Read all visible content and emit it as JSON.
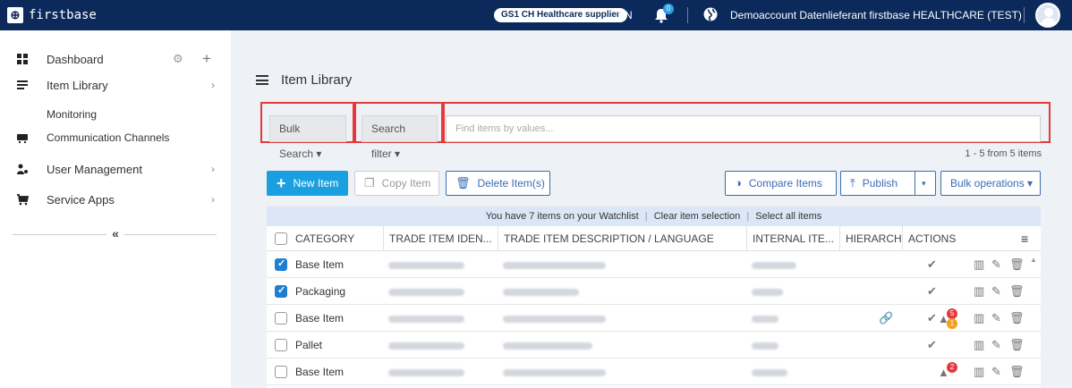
{
  "topbar": {
    "logo_text": "firstbase",
    "supplier_badge": "GS1 CH Healthcare supplier",
    "language": "EN",
    "notification_count": "0",
    "account_name": "Demoaccount Datenlieferant firstbase HEALTHCARE (TEST)"
  },
  "sidebar": {
    "dashboard": "Dashboard",
    "item_library": "Item Library",
    "monitoring": "Monitoring",
    "communication_channels": "Communication Channels",
    "user_management": "User Management",
    "service_apps": "Service Apps",
    "collapse": "«"
  },
  "main": {
    "title": "Item Library",
    "bulk_search": "Bulk Search ▾",
    "search_filter": "Search filter ▾",
    "search_placeholder": "Find items by values...",
    "count": "1 - 5 from 5 items"
  },
  "toolbar": {
    "new_item": "New Item",
    "copy_item": "Copy Item",
    "delete_items": "Delete Item(s)",
    "compare_items": "Compare Items",
    "publish": "Publish",
    "publish_caret": "▾",
    "bulk_operations": "Bulk operations ▾"
  },
  "table": {
    "watchlist_text": "You have 7 items on your Watchlist",
    "clear_selection": "Clear item selection",
    "select_all": "Select all items",
    "separator": "|",
    "headers": {
      "category": "CATEGORY",
      "trade_item_id": "TRADE ITEM IDEN...",
      "description": "TRADE ITEM DESCRIPTION / LANGUAGE",
      "internal": "INTERNAL ITE...",
      "hierarchy": "HIERARCH",
      "actions": "ACTIONS"
    },
    "rows": [
      {
        "category": "Base Item",
        "checked": true
      },
      {
        "category": "Packaging",
        "checked": true
      },
      {
        "category": "Base Item",
        "checked": false,
        "badge_red": "5",
        "badge_orange": "1"
      },
      {
        "category": "Pallet",
        "checked": false
      },
      {
        "category": "Base Item",
        "checked": false,
        "badge_red": "2"
      }
    ]
  }
}
